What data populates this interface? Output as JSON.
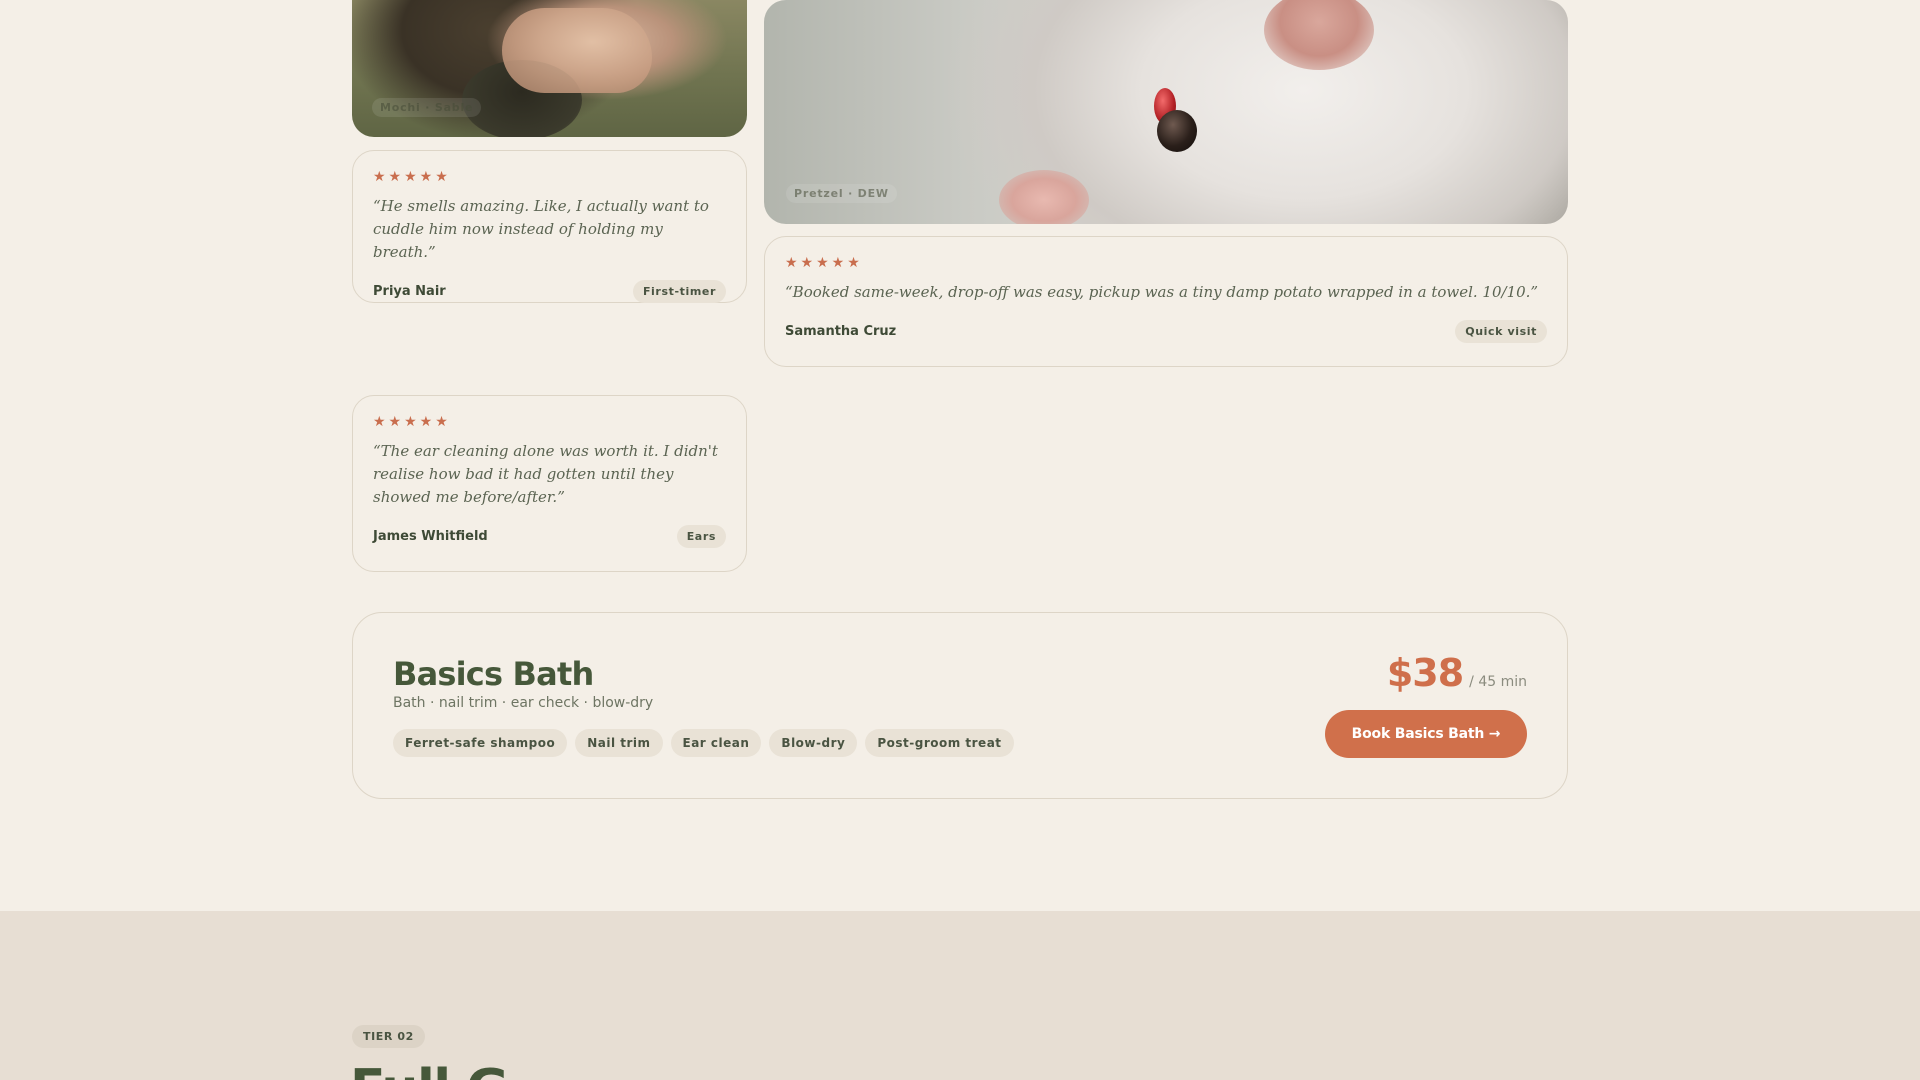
{
  "photos": [
    {
      "caption": "Mochi · Sable"
    },
    {
      "caption": "Pretzel · DEW"
    }
  ],
  "reviews": [
    {
      "stars": "★★★★★",
      "quote": "“He smells amazing. Like, I actually want to cuddle him now instead of holding my breath.”",
      "author": "Priya Nair",
      "tag": "First-timer"
    },
    {
      "stars": "★★★★★",
      "quote": "“Booked same-week, drop-off was easy, pickup was a tiny damp potato wrapped in a towel. 10/10.”",
      "author": "Samantha Cruz",
      "tag": "Quick visit"
    },
    {
      "stars": "★★★★★",
      "quote": "“The ear cleaning alone was worth it. I didn't realise how bad it had gotten until they showed me before/after.”",
      "author": "James Whitfield",
      "tag": "Ears"
    }
  ],
  "plan": {
    "title": "Basics Bath",
    "subtitle": "Bath · nail trim · ear check · blow-dry",
    "features": [
      "Ferret-safe shampoo",
      "Nail trim",
      "Ear clean",
      "Blow-dry",
      "Post-groom treat"
    ],
    "price": "$38",
    "duration": "/ 45 min",
    "cta": "Book Basics Bath →"
  },
  "next_tier": {
    "badge": "TIER 02",
    "title": "Full G"
  },
  "colors": {
    "background": "#f4efe7",
    "accent": "#d0704b",
    "heading": "#46583a",
    "band": "#e7ded3"
  }
}
